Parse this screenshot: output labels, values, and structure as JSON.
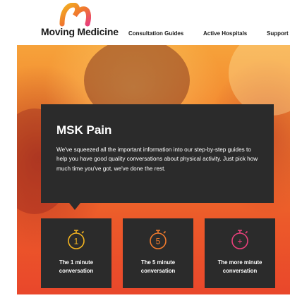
{
  "brand": {
    "name": "Moving Medicine"
  },
  "nav": {
    "items": [
      {
        "label": "Consultation Guides"
      },
      {
        "label": "Active Hospitals"
      },
      {
        "label": "Support"
      }
    ]
  },
  "hero": {
    "title": "MSK Pain",
    "description": "We've squeezed all the important information into our step-by-step guides to help you have good quality conversations about physical activity. Just pick how much time you've got, we've done the rest."
  },
  "options": [
    {
      "label_line1": "The 1 minute",
      "label_line2": "conversation",
      "icon_text": "1",
      "icon": "stopwatch-1-icon",
      "color": "#f2b320"
    },
    {
      "label_line1": "The 5 minute",
      "label_line2": "conversation",
      "icon_text": "5",
      "icon": "stopwatch-5-icon",
      "color": "#f07a2d"
    },
    {
      "label_line1": "The more minute",
      "label_line2": "conversation",
      "icon_text": "+",
      "icon": "stopwatch-plus-icon",
      "color": "#e8407a"
    }
  ],
  "colors": {
    "logo_arc_top": "#f2b320",
    "logo_arc_bottom": "#e8407a",
    "panel": "#2b2b2b"
  }
}
